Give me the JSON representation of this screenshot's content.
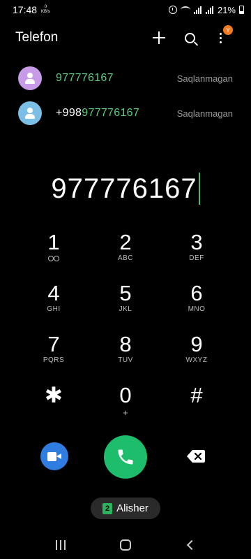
{
  "status_bar": {
    "time": "17:48",
    "net_speed_value": "0",
    "net_speed_unit": "KB/s",
    "battery": "21%"
  },
  "header": {
    "title": "Telefon",
    "badge": "Y"
  },
  "suggestions": [
    {
      "prefix": "",
      "match": "977776167",
      "status": "Saqlanmagan",
      "avatar_color": "#c89be8"
    },
    {
      "prefix": "+998",
      "match": "977776167",
      "status": "Saqlanmagan",
      "avatar_color": "#7bbfe6"
    }
  ],
  "dial": {
    "number": "977776167"
  },
  "keypad": {
    "keys": [
      {
        "digit": "1",
        "letters": ""
      },
      {
        "digit": "2",
        "letters": "ABC"
      },
      {
        "digit": "3",
        "letters": "DEF"
      },
      {
        "digit": "4",
        "letters": "GHI"
      },
      {
        "digit": "5",
        "letters": "JKL"
      },
      {
        "digit": "6",
        "letters": "MNO"
      },
      {
        "digit": "7",
        "letters": "PQRS"
      },
      {
        "digit": "8",
        "letters": "TUV"
      },
      {
        "digit": "9",
        "letters": "WXYZ"
      },
      {
        "digit": "✱",
        "letters": ""
      },
      {
        "digit": "0",
        "letters": "+"
      },
      {
        "digit": "#",
        "letters": ""
      }
    ]
  },
  "sim": {
    "slot": "2",
    "name": "Alisher"
  },
  "colors": {
    "match": "#5fcf7a",
    "call": "#1ebd6b",
    "video": "#2f7de1",
    "sim": "#2bb35e",
    "badge": "#f47a20"
  }
}
